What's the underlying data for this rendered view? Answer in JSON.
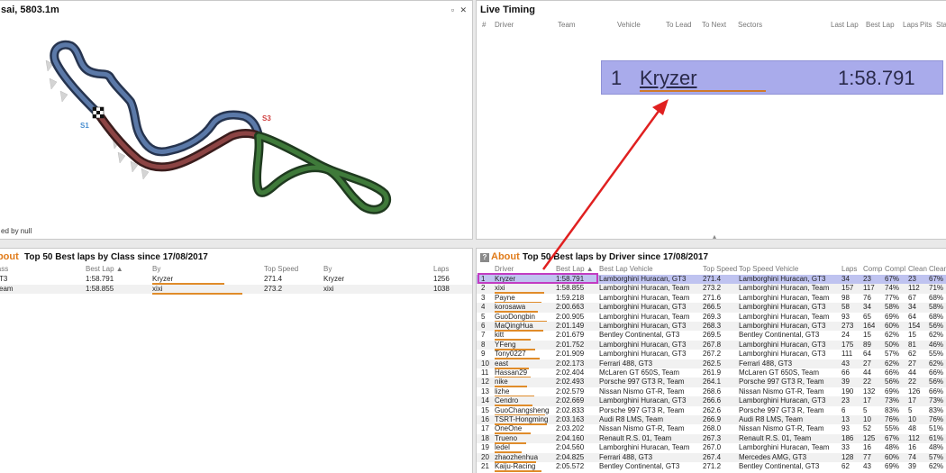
{
  "track": {
    "title": "sai, 5803.1m",
    "footer": "ed by null",
    "sectors": [
      "S1",
      "S3"
    ],
    "buttons": [
      "▫",
      "✕"
    ]
  },
  "live": {
    "title": "Live Timing",
    "columns": [
      "#",
      "Driver",
      "Team",
      "Vehicle",
      "To Lead",
      "To Next",
      "Sectors",
      "Last Lap",
      "Best Lap",
      "Laps",
      "Pits",
      "Sta"
    ],
    "banner": {
      "pos": "1",
      "driver": "Kryzer",
      "time": "1:58.791"
    },
    "buttons": [
      "▫",
      "✕"
    ]
  },
  "class_panel": {
    "about": "About",
    "title": "Top 50 Best laps by Class since 17/08/2017",
    "columns": [
      "lass",
      "Best Lap ▲",
      "By",
      "Top Speed",
      "By",
      "Laps"
    ],
    "rows": [
      {
        "cls": "T3",
        "best": "1:58.791",
        "by": "Kryzer",
        "speed": "271.4",
        "by2": "Kryzer",
        "laps": "1256"
      },
      {
        "cls": "eam",
        "best": "1:58.855",
        "by": "xixi",
        "speed": "273.2",
        "by2": "xixi",
        "laps": "1038"
      }
    ]
  },
  "driver_panel": {
    "about": "About",
    "title": "Top 50 Best laps by Driver since 17/08/2017",
    "columns": [
      "Driver",
      "Best Lap ▲",
      "Best Lap Vehicle",
      "Top Speed",
      "Top Speed Vehicle",
      "Laps",
      "Comp",
      "Compl",
      "Clean",
      "Clean"
    ],
    "rows": [
      [
        "1",
        "Kryzer",
        "1:58.791",
        "Lamborghini Huracan, GT3",
        "271.4",
        "Lamborghini Huracan, GT3",
        "34",
        "23",
        "67%",
        "23",
        "67%"
      ],
      [
        "2",
        "xixi",
        "1:58.855",
        "Lamborghini Huracan, Team",
        "273.2",
        "Lamborghini Huracan, Team",
        "157",
        "117",
        "74%",
        "112",
        "71%"
      ],
      [
        "3",
        "Payne",
        "1:59.218",
        "Lamborghini Huracan, Team",
        "271.6",
        "Lamborghini Huracan, Team",
        "98",
        "76",
        "77%",
        "67",
        "68%"
      ],
      [
        "4",
        "korosawa",
        "2:00.663",
        "Lamborghini Huracan, GT3",
        "266.5",
        "Lamborghini Huracan, GT3",
        "58",
        "34",
        "58%",
        "34",
        "58%"
      ],
      [
        "5",
        "GuoDongbin",
        "2:00.905",
        "Lamborghini Huracan, Team",
        "269.3",
        "Lamborghini Huracan, Team",
        "93",
        "65",
        "69%",
        "64",
        "68%"
      ],
      [
        "6",
        "MaQingHua",
        "2:01.149",
        "Lamborghini Huracan, GT3",
        "268.3",
        "Lamborghini Huracan, GT3",
        "273",
        "164",
        "60%",
        "154",
        "56%"
      ],
      [
        "7",
        "kitt",
        "2:01.679",
        "Bentley Continental, GT3",
        "269.5",
        "Bentley Continental, GT3",
        "24",
        "15",
        "62%",
        "15",
        "62%"
      ],
      [
        "8",
        "YFeng",
        "2:01.752",
        "Lamborghini Huracan, GT3",
        "267.8",
        "Lamborghini Huracan, GT3",
        "175",
        "89",
        "50%",
        "81",
        "46%"
      ],
      [
        "9",
        "Tony0227",
        "2:01.909",
        "Lamborghini Huracan, GT3",
        "267.2",
        "Lamborghini Huracan, GT3",
        "111",
        "64",
        "57%",
        "62",
        "55%"
      ],
      [
        "10",
        "east",
        "2:02.173",
        "Ferrari 488, GT3",
        "262.5",
        "Ferrari 488, GT3",
        "43",
        "27",
        "62%",
        "27",
        "62%"
      ],
      [
        "11",
        "Hassan29",
        "2:02.404",
        "McLaren GT 650S, Team",
        "261.9",
        "McLaren GT 650S, Team",
        "66",
        "44",
        "66%",
        "44",
        "66%"
      ],
      [
        "12",
        "nike",
        "2:02.493",
        "Porsche 997 GT3 R, Team",
        "264.1",
        "Porsche 997 GT3 R, Team",
        "39",
        "22",
        "56%",
        "22",
        "56%"
      ],
      [
        "13",
        "lizhe",
        "2:02.579",
        "Nissan Nismo GT-R, Team",
        "268.6",
        "Nissan Nismo GT-R, Team",
        "190",
        "132",
        "69%",
        "126",
        "66%"
      ],
      [
        "14",
        "Cendro",
        "2:02.669",
        "Lamborghini Huracan, GT3",
        "266.6",
        "Lamborghini Huracan, GT3",
        "23",
        "17",
        "73%",
        "17",
        "73%"
      ],
      [
        "15",
        "GuoChangsheng",
        "2:02.833",
        "Porsche 997 GT3 R, Team",
        "262.6",
        "Porsche 997 GT3 R, Team",
        "6",
        "5",
        "83%",
        "5",
        "83%"
      ],
      [
        "16",
        "TSRT-Hongming",
        "2:03.163",
        "Audi R8 LMS, Team",
        "266.9",
        "Audi R8 LMS, Team",
        "13",
        "10",
        "76%",
        "10",
        "76%"
      ],
      [
        "17",
        "OneOne",
        "2:03.202",
        "Nissan Nismo GT-R, Team",
        "268.0",
        "Nissan Nismo GT-R, Team",
        "93",
        "52",
        "55%",
        "48",
        "51%"
      ],
      [
        "18",
        "Trueno",
        "2:04.160",
        "Renault R.S. 01, Team",
        "267.3",
        "Renault R.S. 01, Team",
        "186",
        "125",
        "67%",
        "112",
        "61%"
      ],
      [
        "19",
        "ledel",
        "2:04.560",
        "Lamborghini Huracan, Team",
        "267.0",
        "Lamborghini Huracan, Team",
        "33",
        "16",
        "48%",
        "16",
        "48%"
      ],
      [
        "20",
        "zhaozhenhua",
        "2:04.825",
        "Ferrari 488, GT3",
        "267.4",
        "Mercedes AMG, GT3",
        "128",
        "77",
        "60%",
        "74",
        "57%"
      ],
      [
        "21",
        "Kaiju-Racing",
        "2:05.572",
        "Bentley Continental, GT3",
        "271.2",
        "Bentley Continental, GT3",
        "62",
        "43",
        "69%",
        "39",
        "62%"
      ]
    ]
  }
}
